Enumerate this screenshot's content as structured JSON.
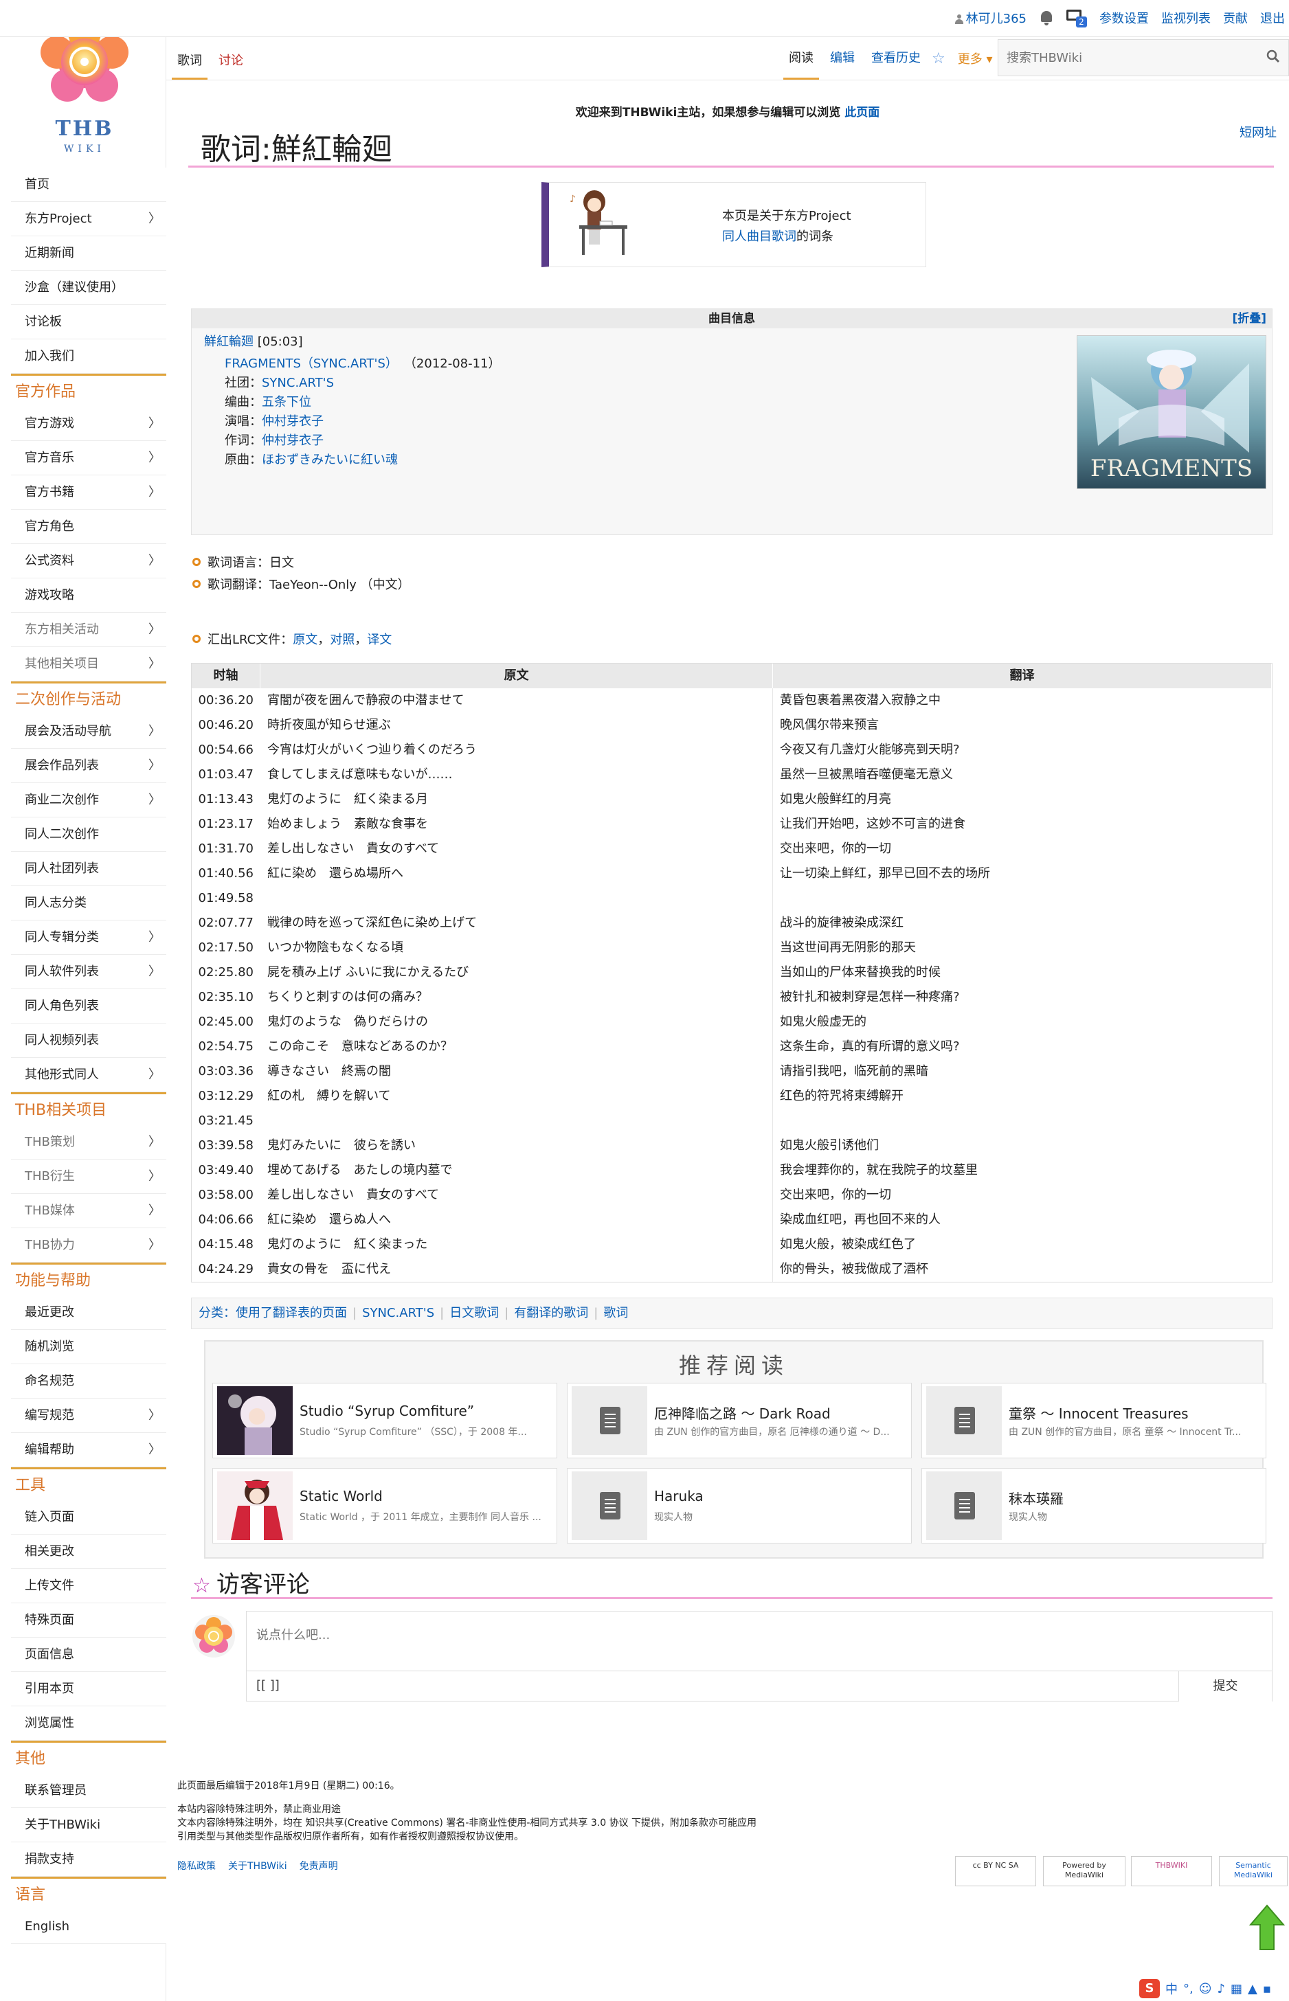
{
  "personal": {
    "user": "林可儿365",
    "badge_count": "2",
    "links": [
      "参数设置",
      "监视列表",
      "贡献",
      "退出"
    ]
  },
  "logo": {
    "name": "THB",
    "sub": "WIKI"
  },
  "sidebar": {
    "top": [
      {
        "label": "首页"
      },
      {
        "label": "东方Project",
        "chev": "〉"
      },
      {
        "label": "近期新闻"
      },
      {
        "label": "沙盒（建议使用）"
      },
      {
        "label": "讨论板"
      },
      {
        "label": "加入我们"
      }
    ],
    "sections": [
      {
        "title": "官方作品",
        "items": [
          {
            "label": "官方游戏",
            "chev": "〉"
          },
          {
            "label": "官方音乐",
            "chev": "〉"
          },
          {
            "label": "官方书籍",
            "chev": "〉"
          },
          {
            "label": "官方角色"
          },
          {
            "label": "公式资料",
            "chev": "〉"
          },
          {
            "label": "游戏攻略"
          },
          {
            "label": "东方相关活动",
            "chev": "〉",
            "dim": true
          },
          {
            "label": "其他相关项目",
            "chev": "〉",
            "dim": true
          }
        ]
      },
      {
        "title": "二次创作与活动",
        "items": [
          {
            "label": "展会及活动导航",
            "chev": "〉"
          },
          {
            "label": "展会作品列表",
            "chev": "〉"
          },
          {
            "label": "商业二次创作",
            "chev": "〉"
          },
          {
            "label": "同人二次创作"
          },
          {
            "label": "同人社团列表"
          },
          {
            "label": "同人志分类"
          },
          {
            "label": "同人专辑分类",
            "chev": "〉"
          },
          {
            "label": "同人软件列表",
            "chev": "〉"
          },
          {
            "label": "同人角色列表"
          },
          {
            "label": "同人视频列表"
          },
          {
            "label": "其他形式同人",
            "chev": "〉"
          }
        ]
      },
      {
        "title": "THB相关项目",
        "items": [
          {
            "label": "THB策划",
            "chev": "〉",
            "dim": true
          },
          {
            "label": "THB衍生",
            "chev": "〉",
            "dim": true
          },
          {
            "label": "THB媒体",
            "chev": "〉",
            "dim": true
          },
          {
            "label": "THB协力",
            "chev": "〉",
            "dim": true
          }
        ]
      },
      {
        "title": "功能与帮助",
        "items": [
          {
            "label": "最近更改"
          },
          {
            "label": "随机浏览"
          },
          {
            "label": "命名规范"
          },
          {
            "label": "编写规范",
            "chev": "〉"
          },
          {
            "label": "编辑帮助",
            "chev": "〉"
          }
        ]
      },
      {
        "title": "工具",
        "items": [
          {
            "label": "链入页面"
          },
          {
            "label": "相关更改"
          },
          {
            "label": "上传文件"
          },
          {
            "label": "特殊页面"
          },
          {
            "label": "页面信息"
          },
          {
            "label": "引用本页"
          },
          {
            "label": "浏览属性"
          }
        ]
      },
      {
        "title": "其他",
        "items": [
          {
            "label": "联系管理员"
          },
          {
            "label": "关于THBWiki"
          },
          {
            "label": "捐款支持"
          }
        ]
      },
      {
        "title": "语言",
        "items": [
          {
            "label": "English"
          }
        ]
      }
    ]
  },
  "tabs": {
    "left": [
      {
        "label": "歌词"
      },
      {
        "label": "讨论"
      }
    ],
    "right": [
      {
        "label": "阅读"
      },
      {
        "label": "编辑"
      },
      {
        "label": "查看历史"
      }
    ],
    "more": "更多"
  },
  "search": {
    "placeholder": "搜索THBWiki"
  },
  "notice": {
    "pre": "欢迎来到THBWiki主站，如果想参与编辑可以浏览",
    "link": "此页面"
  },
  "short_url": "短网址",
  "page_title": "歌词:鮮紅輪廻",
  "ambox": {
    "line1": "本页是关于东方Project",
    "link": "同人曲目歌词",
    "line2_suffix": "的词条"
  },
  "infobox": {
    "header": "曲目信息",
    "fold": "[折叠]",
    "song": "鮮紅輪廻",
    "duration": "[05:03]",
    "album": "FRAGMENTS（SYNC.ART'S）",
    "date": "（2012-08-11）",
    "fields": [
      {
        "k": "社团：",
        "v": "SYNC.ART'S"
      },
      {
        "k": "编曲：",
        "v": "五条下位"
      },
      {
        "k": "演唱：",
        "v": "仲村芽衣子"
      },
      {
        "k": "作词：",
        "v": "仲村芽衣子"
      },
      {
        "k": "原曲：",
        "v": "ほおずきみたいに紅い魂"
      }
    ],
    "cover_text": "FRAGMENTS"
  },
  "meta": {
    "lang_label": "歌词语言：",
    "lang": "日文",
    "trans_label": "歌词翻译：",
    "trans": "TaeYeon--Only （中文）",
    "lrc_label": "汇出LRC文件：",
    "lrc": [
      "原文",
      "对照",
      "译文"
    ]
  },
  "lyrics": {
    "headers": [
      "时轴",
      "原文",
      "翻译"
    ],
    "rows": [
      [
        "00:36.20",
        "宵闇が夜を囲んで静寂の中潜ませて",
        "黄昏包裹着黑夜潜入寂静之中"
      ],
      [
        "00:46.20",
        "時折夜風が知らせ運ぶ",
        "晚风偶尔带来预言"
      ],
      [
        "00:54.66",
        "今宵は灯火がいくつ辿り着くのだろう",
        "今夜又有几盏灯火能够亮到天明?"
      ],
      [
        "01:03.47",
        "食してしまえば意味もないが……",
        "虽然一旦被黑暗吞噬便毫无意义"
      ],
      [
        "01:13.43",
        "鬼灯のように　紅く染まる月",
        "如鬼火般鲜红的月亮"
      ],
      [
        "01:23.17",
        "始めましょう　素敵な食事を",
        "让我们开始吧，这妙不可言的进食"
      ],
      [
        "01:31.70",
        "差し出しなさい　貴女のすべて",
        "交出来吧，你的一切"
      ],
      [
        "01:40.56",
        "紅に染め　還らぬ場所へ",
        "让一切染上鲜红，那早已回不去的场所"
      ],
      [
        "01:49.58",
        "",
        ""
      ],
      [
        "02:07.77",
        "戦律の時を巡って深紅色に染め上げて",
        "战斗的旋律被染成深红"
      ],
      [
        "02:17.50",
        "いつか物陰もなくなる頃",
        "当这世间再无阴影的那天"
      ],
      [
        "02:25.80",
        "屍を積み上げ ふいに我にかえるたび",
        "当如山的尸体来替换我的时候"
      ],
      [
        "02:35.10",
        "ちくりと刺すのは何の痛み？",
        "被针扎和被刺穿是怎样一种疼痛?"
      ],
      [
        "02:45.00",
        "鬼灯のような　偽りだらけの",
        "如鬼火般虚无的"
      ],
      [
        "02:54.75",
        "この命こそ　意味などあるのか？",
        "这条生命，真的有所谓的意义吗?"
      ],
      [
        "03:03.36",
        "導きなさい　終焉の闇",
        "请指引我吧，临死前的黑暗"
      ],
      [
        "03:12.29",
        "紅の札　縛りを解いて",
        "红色的符咒将束缚解开"
      ],
      [
        "03:21.45",
        "",
        ""
      ],
      [
        "03:39.58",
        "鬼灯みたいに　彼らを誘い",
        "如鬼火般引诱他们"
      ],
      [
        "03:49.40",
        "埋めてあげる　あたしの境内墓で",
        "我会埋葬你的，就在我院子的坟墓里"
      ],
      [
        "03:58.00",
        "差し出しなさい　貴女のすべて",
        "交出来吧，你的一切"
      ],
      [
        "04:06.66",
        "紅に染め　還らぬ人へ",
        "染成血红吧，再也回不来的人"
      ],
      [
        "04:15.48",
        "鬼灯のように　紅く染まった",
        "如鬼火般，被染成红色了"
      ],
      [
        "04:24.29",
        "貴女の骨を　盃に代え",
        "你的骨头，被我做成了酒杯"
      ]
    ]
  },
  "categories": {
    "label": "分类：",
    "items": [
      "使用了翻译表的页面",
      "SYNC.ART'S",
      "日文歌词",
      "有翻译的歌词",
      "歌词"
    ]
  },
  "recommend": {
    "title": "推荐阅读",
    "cards": [
      {
        "title": "Studio “Syrup Comfiture”",
        "sub": "Studio “Syrup Comfiture” （SSC），于 2008 年..."
      },
      {
        "title": "厄神降临之路 ～ Dark Road",
        "sub": "由 ZUN 创作的官方曲目，原名 厄神様の通り道 ～ D..."
      },
      {
        "title": "童祭 ～ Innocent Treasures",
        "sub": "由 ZUN 创作的官方曲目，原名 童祭 ～ Innocent Tr..."
      },
      {
        "title": "Static World",
        "sub": "Static World ，于 2011 年成立，主要制作 同人音乐 ..."
      },
      {
        "title": "Haruka",
        "sub": "现实人物"
      },
      {
        "title": "秣本瑛羅",
        "sub": "现实人物"
      }
    ]
  },
  "comments": {
    "title": "访客评论",
    "placeholder": "说点什么吧...",
    "tool": "[[ ]]",
    "submit": "提交"
  },
  "footer": {
    "edited": "此页面最后编辑于2018年1月9日 (星期二) 00:16。",
    "license1": "本站内容除特殊注明外，禁止商业用途",
    "license2": "文本内容除特殊注明外，均在 知识共享(Creative Commons) 署名-非商业性使用-相同方式共享 3.0 协议 下提供，附加条款亦可能应用",
    "license3": "引用类型与其他类型作品版权归原作者所有，如有作者授权则遵照授权协议使用。",
    "links": [
      "隐私政策",
      "关于THBWiki",
      "免责声明"
    ],
    "badges": [
      "cc BY NC SA",
      "Powered by MediaWiki",
      "THBWIKI",
      "Semantic MediaWiki"
    ]
  },
  "ime": {
    "label": "中"
  }
}
